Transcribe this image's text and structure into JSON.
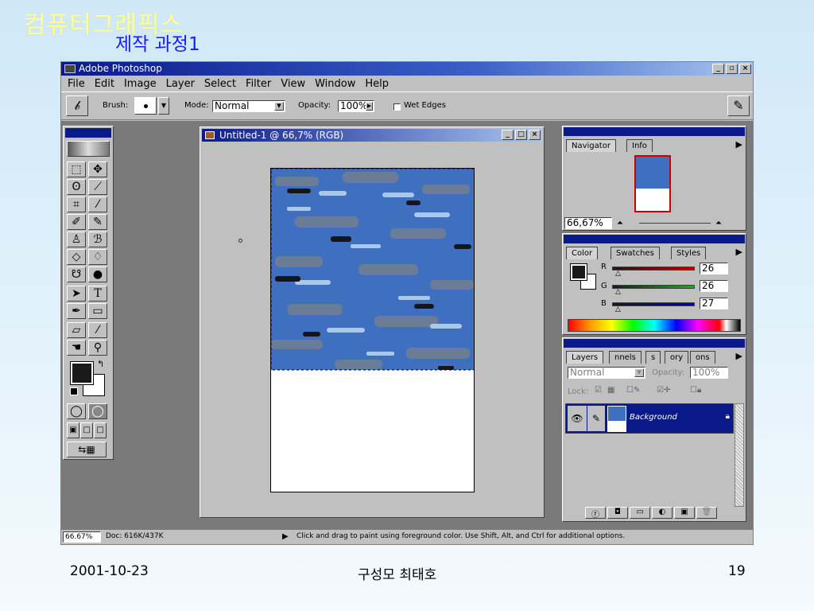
{
  "slide": {
    "title": "컴퓨터그래픽스",
    "subtitle": "제작 과정1",
    "footer_date": "2001-10-23",
    "footer_author": "구성모 최태호",
    "page_number": "19"
  },
  "app": {
    "window_title": "Adobe Photoshop",
    "menu": [
      "File",
      "Edit",
      "Image",
      "Layer",
      "Select",
      "Filter",
      "View",
      "Window",
      "Help"
    ],
    "options": {
      "brush_label": "Brush:",
      "mode_label": "Mode:",
      "mode_value": "Normal",
      "opacity_label": "Opacity:",
      "opacity_value": "100%",
      "wet_edges_label": "Wet Edges"
    }
  },
  "document": {
    "title": "Untitled-1 @ 66,7% (RGB)"
  },
  "navigator": {
    "tabs": [
      "Navigator",
      "Info"
    ],
    "zoom": "66,67%"
  },
  "color_panel": {
    "tabs": [
      "Color",
      "Swatches",
      "Styles"
    ],
    "channels": [
      {
        "label": "R",
        "value": "26"
      },
      {
        "label": "G",
        "value": "26"
      },
      {
        "label": "B",
        "value": "27"
      }
    ]
  },
  "layers_panel": {
    "tabs": [
      "Layers",
      "nnels",
      "s",
      "ory",
      "ons"
    ],
    "blend_mode": "Normal",
    "opacity_label": "Opacity:",
    "opacity_value": "100%",
    "lock_label": "Lock:",
    "layer_name": "Background"
  },
  "status": {
    "zoom": "66.67%",
    "doc_size": "Doc: 616K/437K",
    "hint": "Click and drag to paint using foreground color.  Use Shift, Alt, and Ctrl for additional options."
  },
  "colors": {
    "titlebar": "#0a1a8a",
    "camo_bg": "#3f6fbf",
    "foreground": "#1a1a1b"
  }
}
